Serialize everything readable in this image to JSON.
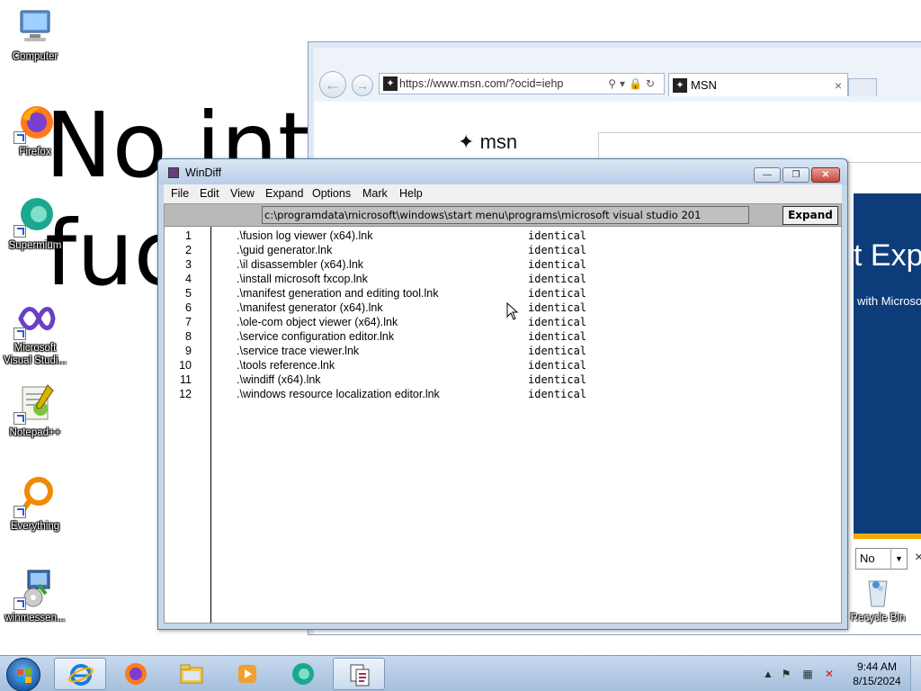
{
  "desktop": {
    "background_text_line1": "No inte",
    "background_text_line2": "fuc",
    "icons": [
      {
        "label": "Computer",
        "icon": "computer-icon"
      },
      {
        "label": "Firefox",
        "icon": "firefox-icon"
      },
      {
        "label": "Supermium",
        "icon": "supermium-icon"
      },
      {
        "label": "Microsoft Visual Studi...",
        "icon": "visual-studio-icon"
      },
      {
        "label": "Notepad++",
        "icon": "notepadpp-icon"
      },
      {
        "label": "Everything",
        "icon": "everything-icon"
      },
      {
        "label": "winmessen...",
        "icon": "installer-icon"
      }
    ],
    "recycle_bin_label": "Recycle Bin"
  },
  "browser": {
    "address": "https://www.msn.com/?ocid=iehp",
    "tab_title": "MSN",
    "logo_text": "msn",
    "banner_big": "t Exple",
    "banner_small": "with Microso",
    "select_value": "No",
    "colors": {
      "banner": "#0c3d7a",
      "strip": "#f2a900"
    }
  },
  "windiff": {
    "title": "WinDiff",
    "menu": [
      "File",
      "Edit",
      "View",
      "Expand",
      "Options",
      "Mark",
      "Help"
    ],
    "path": "c:\\programdata\\microsoft\\windows\\start menu\\programs\\microsoft visual studio 201",
    "expand_label": "Expand",
    "rows": [
      {
        "num": "1",
        "name": ".\\fusion log viewer (x64).lnk",
        "status": "identical"
      },
      {
        "num": "2",
        "name": ".\\guid generator.lnk",
        "status": "identical"
      },
      {
        "num": "3",
        "name": ".\\il disassembler (x64).lnk",
        "status": "identical"
      },
      {
        "num": "4",
        "name": ".\\install microsoft fxcop.lnk",
        "status": "identical"
      },
      {
        "num": "5",
        "name": ".\\manifest generation and editing tool.lnk",
        "status": "identical"
      },
      {
        "num": "6",
        "name": ".\\manifest generator (x64).lnk",
        "status": "identical"
      },
      {
        "num": "7",
        "name": ".\\ole-com object viewer (x64).lnk",
        "status": "identical"
      },
      {
        "num": "8",
        "name": ".\\service configuration editor.lnk",
        "status": "identical"
      },
      {
        "num": "9",
        "name": ".\\service trace viewer.lnk",
        "status": "identical"
      },
      {
        "num": "10",
        "name": ".\\tools reference.lnk",
        "status": "identical"
      },
      {
        "num": "11",
        "name": ".\\windiff (x64).lnk",
        "status": "identical"
      },
      {
        "num": "12",
        "name": ".\\windows resource localization editor.lnk",
        "status": "identical"
      }
    ]
  },
  "taskbar": {
    "buttons": [
      "internet-explorer-icon",
      "firefox-icon",
      "file-explorer-icon",
      "media-player-icon",
      "supermium-icon",
      "windiff-icon"
    ],
    "time": "9:44 AM",
    "date": "8/15/2024"
  }
}
